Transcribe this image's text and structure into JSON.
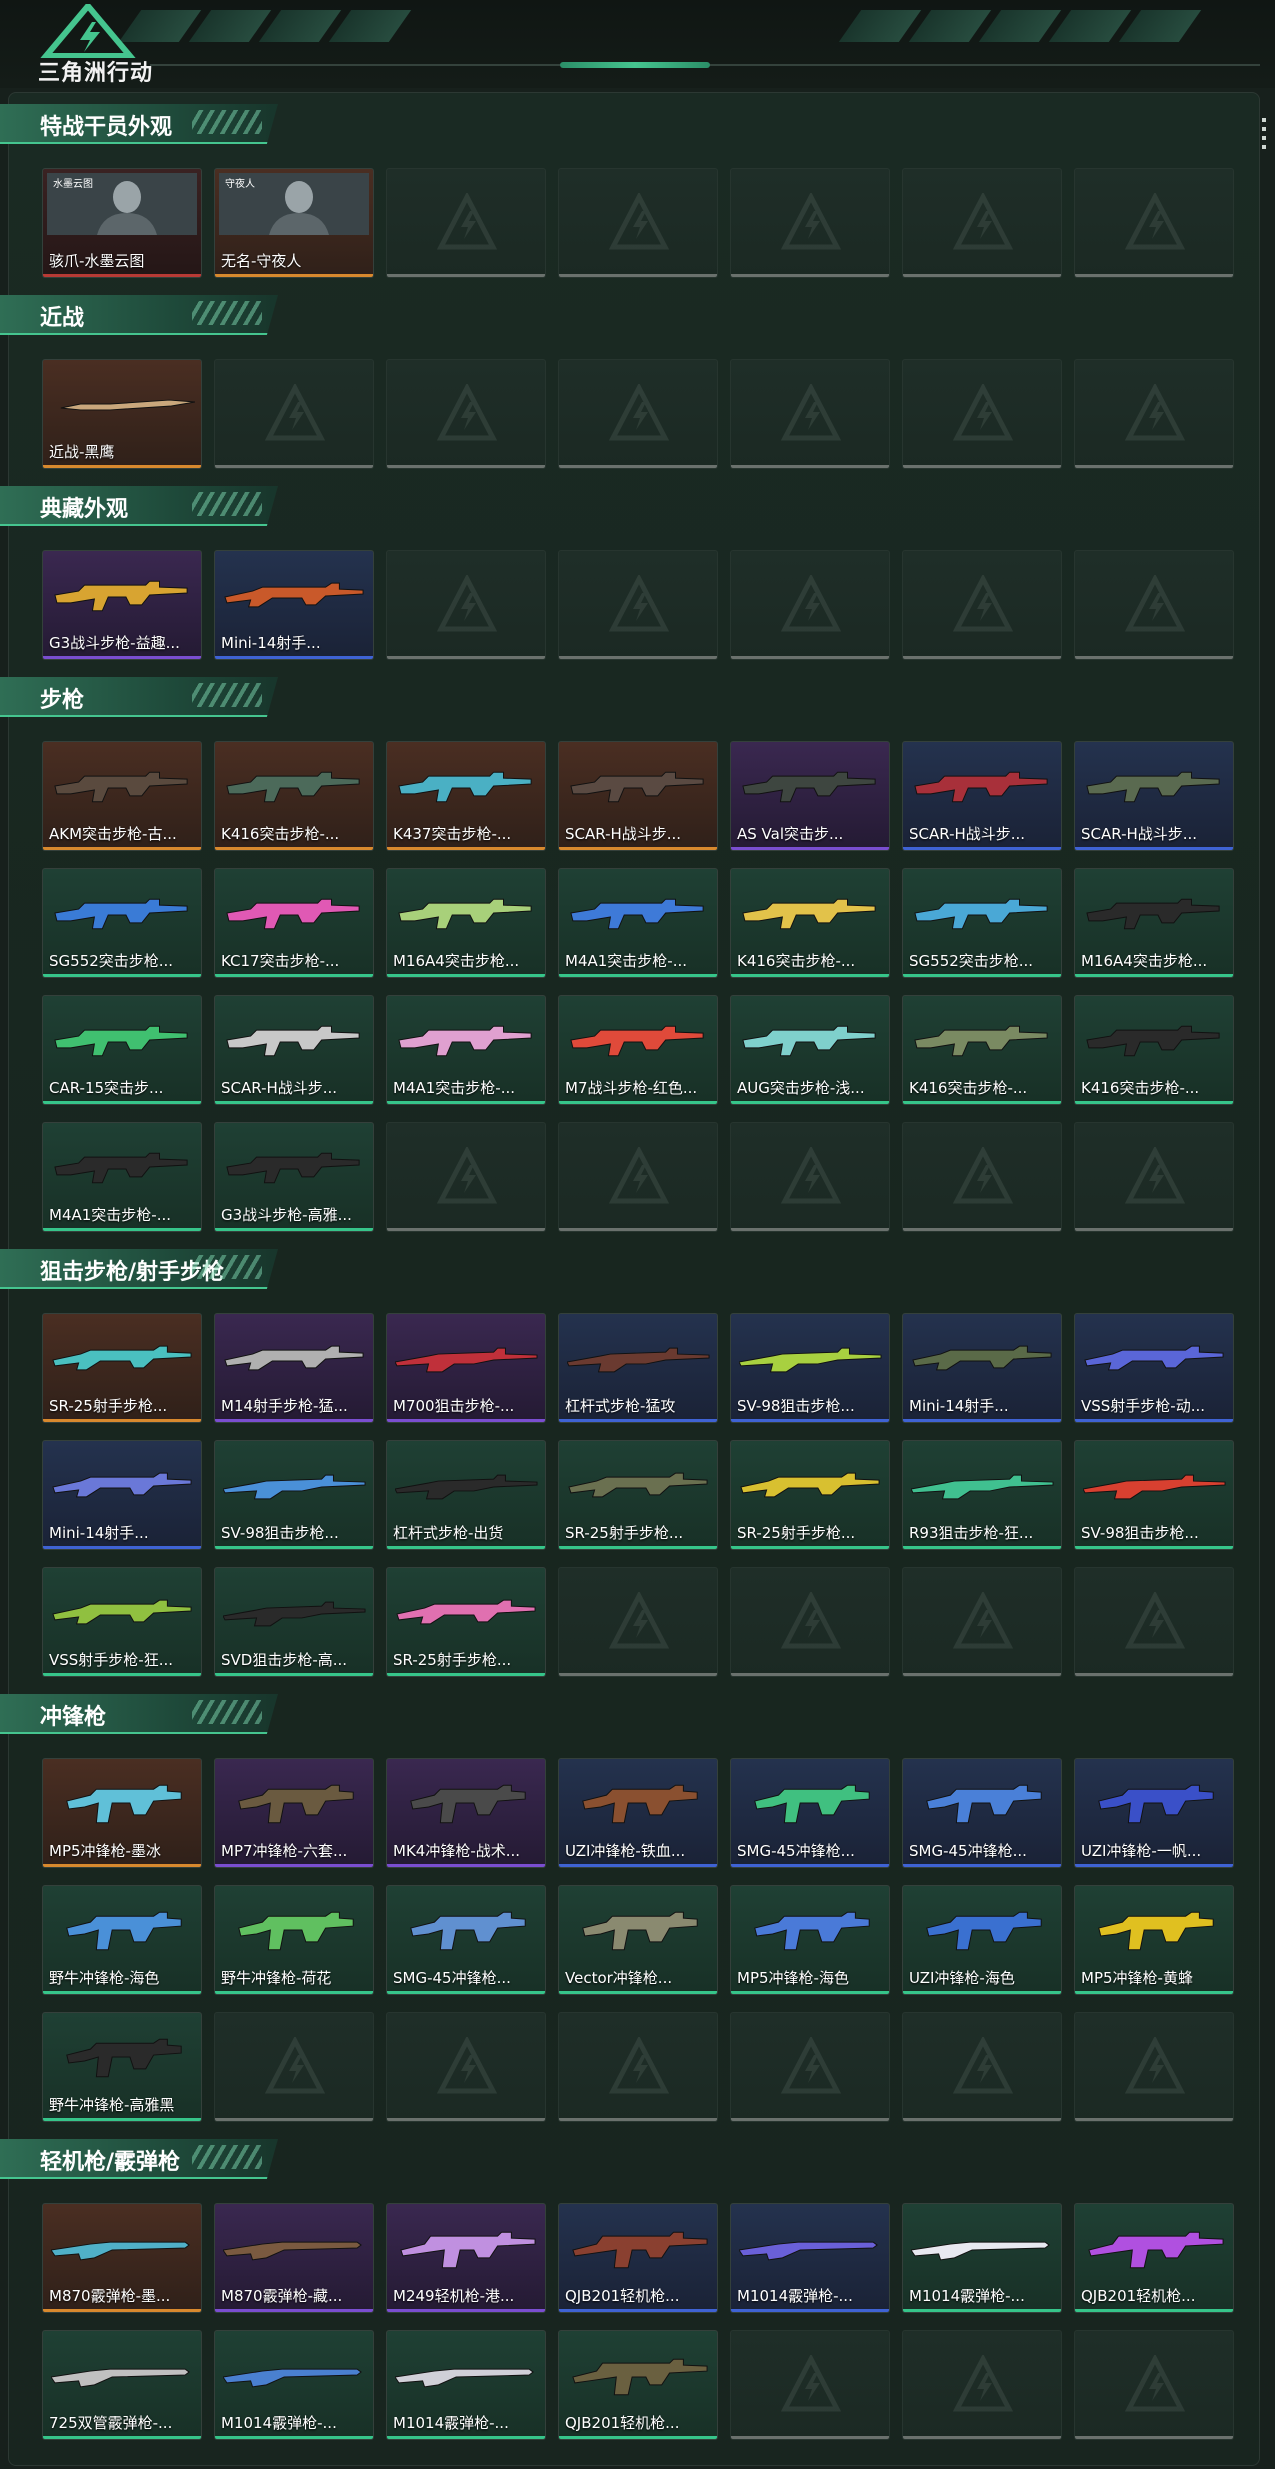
{
  "app": {
    "brand": "三角洲行动",
    "accent": "#45c58f"
  },
  "rarity_colors": {
    "gold": "#d8892e",
    "purple": "#7a4ed0",
    "blue": "#3f63d4",
    "green": "#36c58a",
    "red": "#b83a35"
  },
  "sections": [
    {
      "title": "特战干员外观",
      "rows": 1,
      "items": [
        {
          "name": "骇爪-水墨云图",
          "rarity": "red",
          "kind": "operator",
          "badge": "水墨云图"
        },
        {
          "name": "无名-守夜人",
          "rarity": "gold",
          "kind": "operator",
          "badge": "守夜人"
        }
      ]
    },
    {
      "title": "近战",
      "rows": 1,
      "items": [
        {
          "name": "近战-黑鹰",
          "rarity": "gold",
          "kind": "knife",
          "color": "#c9a77c"
        }
      ]
    },
    {
      "title": "典藏外观",
      "rows": 1,
      "items": [
        {
          "name": "G3战斗步枪-益趣...",
          "rarity": "purple",
          "kind": "rifle",
          "color": "#d8a431"
        },
        {
          "name": "Mini-14射手...",
          "rarity": "blue",
          "kind": "dmr",
          "color": "#c9592a"
        }
      ]
    },
    {
      "title": "步枪",
      "rows": 4,
      "items": [
        {
          "name": "AKM突击步枪-古...",
          "rarity": "gold",
          "kind": "rifle",
          "color": "#5a4a3e"
        },
        {
          "name": "K416突击步枪-...",
          "rarity": "gold",
          "kind": "rifle",
          "color": "#4c6a5a"
        },
        {
          "name": "K437突击步枪-...",
          "rarity": "gold",
          "kind": "rifle",
          "color": "#4ab0c4"
        },
        {
          "name": "SCAR-H战斗步...",
          "rarity": "gold",
          "kind": "rifle",
          "color": "#5a4a42"
        },
        {
          "name": "AS Val突击步...",
          "rarity": "purple",
          "kind": "rifle",
          "color": "#3e4640"
        },
        {
          "name": "SCAR-H战斗步...",
          "rarity": "blue",
          "kind": "rifle",
          "color": "#a8303a"
        },
        {
          "name": "SCAR-H战斗步...",
          "rarity": "blue",
          "kind": "rifle",
          "color": "#5a6a50"
        },
        {
          "name": "SG552突击步枪...",
          "rarity": "green",
          "kind": "rifle",
          "color": "#3a7bd6"
        },
        {
          "name": "KC17突击步枪-...",
          "rarity": "green",
          "kind": "rifle",
          "color": "#e059b4"
        },
        {
          "name": "M16A4突击步枪...",
          "rarity": "green",
          "kind": "rifle",
          "color": "#a8d07a"
        },
        {
          "name": "M4A1突击步枪-...",
          "rarity": "green",
          "kind": "rifle",
          "color": "#3e7ad8"
        },
        {
          "name": "K416突击步枪-...",
          "rarity": "green",
          "kind": "rifle",
          "color": "#e2c24a"
        },
        {
          "name": "SG552突击步枪...",
          "rarity": "green",
          "kind": "rifle",
          "color": "#4aa8d6"
        },
        {
          "name": "M16A4突击步枪...",
          "rarity": "green",
          "kind": "rifle",
          "color": "#2a2a2a"
        },
        {
          "name": "CAR-15突击步...",
          "rarity": "green",
          "kind": "rifle",
          "color": "#40c070"
        },
        {
          "name": "SCAR-H战斗步...",
          "rarity": "green",
          "kind": "rifle",
          "color": "#c8c8c8"
        },
        {
          "name": "M4A1突击步枪-...",
          "rarity": "green",
          "kind": "rifle",
          "color": "#e0a0d0"
        },
        {
          "name": "M7战斗步枪-红色...",
          "rarity": "green",
          "kind": "rifle",
          "color": "#e04a3a"
        },
        {
          "name": "AUG突击步枪-浅...",
          "rarity": "green",
          "kind": "rifle",
          "color": "#7fd0cc"
        },
        {
          "name": "K416突击步枪-...",
          "rarity": "green",
          "kind": "rifle",
          "color": "#7a8a62"
        },
        {
          "name": "K416突击步枪-...",
          "rarity": "green",
          "kind": "rifle",
          "color": "#2a2a2a"
        },
        {
          "name": "M4A1突击步枪-...",
          "rarity": "green",
          "kind": "rifle",
          "color": "#2a2a2a"
        },
        {
          "name": "G3战斗步枪-高雅...",
          "rarity": "green",
          "kind": "rifle",
          "color": "#2a2a2a"
        }
      ]
    },
    {
      "title": "狙击步枪/射手步枪",
      "rows": 3,
      "items": [
        {
          "name": "SR-25射手步枪...",
          "rarity": "gold",
          "kind": "dmr",
          "color": "#4ac0c0"
        },
        {
          "name": "M14射手步枪-猛...",
          "rarity": "purple",
          "kind": "dmr",
          "color": "#b0b0b0"
        },
        {
          "name": "M700狙击步枪-...",
          "rarity": "purple",
          "kind": "sniper",
          "color": "#c0303a"
        },
        {
          "name": "杠杆式步枪-猛攻",
          "rarity": "blue",
          "kind": "sniper",
          "color": "#6a3a30"
        },
        {
          "name": "SV-98狙击步枪...",
          "rarity": "blue",
          "kind": "sniper",
          "color": "#a8d040"
        },
        {
          "name": "Mini-14射手...",
          "rarity": "blue",
          "kind": "dmr",
          "color": "#5a6a48"
        },
        {
          "name": "VSS射手步枪-动...",
          "rarity": "blue",
          "kind": "dmr",
          "color": "#5a66d8"
        },
        {
          "name": "Mini-14射手...",
          "rarity": "blue",
          "kind": "dmr",
          "color": "#6a78d8"
        },
        {
          "name": "SV-98狙击步枪...",
          "rarity": "green",
          "kind": "sniper",
          "color": "#4a90d8"
        },
        {
          "name": "杠杆式步枪-出货",
          "rarity": "green",
          "kind": "sniper",
          "color": "#2a2a2a"
        },
        {
          "name": "SR-25射手步枪...",
          "rarity": "green",
          "kind": "dmr",
          "color": "#6a7050"
        },
        {
          "name": "SR-25射手步枪...",
          "rarity": "green",
          "kind": "dmr",
          "color": "#d8c030"
        },
        {
          "name": "R93狙击步枪-狂...",
          "rarity": "green",
          "kind": "sniper",
          "color": "#40c090"
        },
        {
          "name": "SV-98狙击步枪...",
          "rarity": "green",
          "kind": "sniper",
          "color": "#d84030"
        },
        {
          "name": "VSS射手步枪-狂...",
          "rarity": "green",
          "kind": "dmr",
          "color": "#90c040"
        },
        {
          "name": "SVD狙击步枪-高...",
          "rarity": "green",
          "kind": "sniper",
          "color": "#2a2a2a"
        },
        {
          "name": "SR-25射手步枪...",
          "rarity": "green",
          "kind": "dmr",
          "color": "#e070b0"
        }
      ]
    },
    {
      "title": "冲锋枪",
      "rows": 3,
      "items": [
        {
          "name": "MP5冲锋枪-墨冰",
          "rarity": "gold",
          "kind": "smg",
          "color": "#60c0d8"
        },
        {
          "name": "MP7冲锋枪-六套...",
          "rarity": "purple",
          "kind": "smg",
          "color": "#6a5a40"
        },
        {
          "name": "MK4冲锋枪-战术...",
          "rarity": "purple",
          "kind": "smg",
          "color": "#4a4a4a"
        },
        {
          "name": "UZI冲锋枪-铁血...",
          "rarity": "blue",
          "kind": "smg",
          "color": "#8a5030"
        },
        {
          "name": "SMG-45冲锋枪...",
          "rarity": "blue",
          "kind": "smg",
          "color": "#40c080"
        },
        {
          "name": "SMG-45冲锋枪...",
          "rarity": "blue",
          "kind": "smg",
          "color": "#4a80d8"
        },
        {
          "name": "UZI冲锋枪-一帆...",
          "rarity": "blue",
          "kind": "smg",
          "color": "#3a50c8"
        },
        {
          "name": "野牛冲锋枪-海色",
          "rarity": "green",
          "kind": "smg",
          "color": "#4a90d8"
        },
        {
          "name": "野牛冲锋枪-荷花",
          "rarity": "green",
          "kind": "smg",
          "color": "#60c060"
        },
        {
          "name": "SMG-45冲锋枪...",
          "rarity": "green",
          "kind": "smg",
          "color": "#6090d0"
        },
        {
          "name": "Vector冲锋枪...",
          "rarity": "green",
          "kind": "smg",
          "color": "#8a8a70"
        },
        {
          "name": "MP5冲锋枪-海色",
          "rarity": "green",
          "kind": "smg",
          "color": "#4a7ad8"
        },
        {
          "name": "UZI冲锋枪-海色",
          "rarity": "green",
          "kind": "smg",
          "color": "#3a70d0"
        },
        {
          "name": "MP5冲锋枪-黄蜂",
          "rarity": "green",
          "kind": "smg",
          "color": "#e0c020"
        },
        {
          "name": "野牛冲锋枪-高雅黑",
          "rarity": "green",
          "kind": "smg",
          "color": "#2a2a2a"
        }
      ]
    },
    {
      "title": "轻机枪/霰弹枪",
      "rows": 2,
      "items": [
        {
          "name": "M870霰弹枪-墨...",
          "rarity": "gold",
          "kind": "shotgun",
          "color": "#50b0c8"
        },
        {
          "name": "M870霰弹枪-藏...",
          "rarity": "purple",
          "kind": "shotgun",
          "color": "#7a5a40"
        },
        {
          "name": "M249轻机枪-港...",
          "rarity": "purple",
          "kind": "lmg",
          "color": "#c090e0"
        },
        {
          "name": "QJB201轻机枪...",
          "rarity": "blue",
          "kind": "lmg",
          "color": "#8a4030"
        },
        {
          "name": "M1014霰弹枪-...",
          "rarity": "blue",
          "kind": "shotgun",
          "color": "#6a60d8"
        },
        {
          "name": "M1014霰弹枪-...",
          "rarity": "green",
          "kind": "shotgun",
          "color": "#e8e8f0"
        },
        {
          "name": "QJB201轻机枪...",
          "rarity": "green",
          "kind": "lmg",
          "color": "#b050e0"
        },
        {
          "name": "725双管霰弹枪-...",
          "rarity": "green",
          "kind": "shotgun",
          "color": "#c0c0c0"
        },
        {
          "name": "M1014霰弹枪-...",
          "rarity": "green",
          "kind": "shotgun",
          "color": "#4a80d0"
        },
        {
          "name": "M1014霰弹枪-...",
          "rarity": "green",
          "kind": "shotgun",
          "color": "#d0d0d8"
        },
        {
          "name": "QJB201轻机枪...",
          "rarity": "green",
          "kind": "lmg",
          "color": "#6a6040"
        }
      ]
    }
  ]
}
